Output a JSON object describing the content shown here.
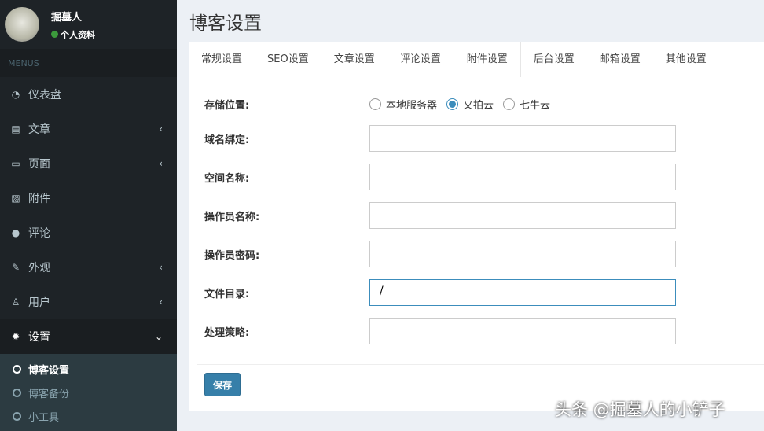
{
  "user": {
    "name": "掘墓人",
    "profile": "个人资料",
    "status_color": "#3c9a3c"
  },
  "sidebar": {
    "header": "MENUS",
    "items": [
      {
        "label": "仪表盘",
        "icon": "dashboard-icon",
        "glyph": "◔",
        "chev": ""
      },
      {
        "label": "文章",
        "icon": "book-icon",
        "glyph": "▤",
        "chev": "‹"
      },
      {
        "label": "页面",
        "icon": "desktop-icon",
        "glyph": "▭",
        "chev": "‹"
      },
      {
        "label": "附件",
        "icon": "image-icon",
        "glyph": "▨",
        "chev": ""
      },
      {
        "label": "评论",
        "icon": "comment-icon",
        "glyph": "●",
        "chev": ""
      },
      {
        "label": "外观",
        "icon": "brush-icon",
        "glyph": "✎",
        "chev": "‹"
      },
      {
        "label": "用户",
        "icon": "user-icon",
        "glyph": "♙",
        "chev": "‹"
      },
      {
        "label": "设置",
        "icon": "gear-icon",
        "glyph": "✹",
        "chev": "⌄"
      }
    ],
    "subitems": [
      "博客设置",
      "博客备份",
      "小工具"
    ]
  },
  "page": {
    "title": "博客设置"
  },
  "tabs": [
    "常规设置",
    "SEO设置",
    "文章设置",
    "评论设置",
    "附件设置",
    "后台设置",
    "邮箱设置",
    "其他设置"
  ],
  "form": {
    "storage_label": "存储位置:",
    "storage_options": [
      "本地服务器",
      "又拍云",
      "七牛云"
    ],
    "storage_selected": "又拍云",
    "fields": [
      {
        "label": "域名绑定:",
        "value": ""
      },
      {
        "label": "空间名称:",
        "value": ""
      },
      {
        "label": "操作员名称:",
        "value": ""
      },
      {
        "label": "操作员密码:",
        "value": ""
      },
      {
        "label": "文件目录:",
        "value": "/"
      },
      {
        "label": "处理策略:",
        "value": ""
      }
    ],
    "save": "保存"
  },
  "watermark": "头条 @掘墓人的小铲子"
}
